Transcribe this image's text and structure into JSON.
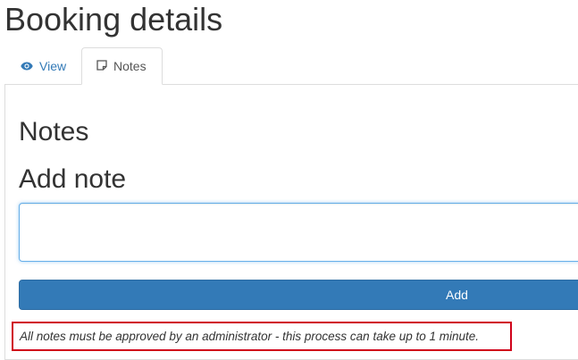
{
  "page": {
    "title": "Booking details"
  },
  "tabs": [
    {
      "label": "View",
      "icon": "eye-icon",
      "active": false
    },
    {
      "label": "Notes",
      "icon": "note-icon",
      "active": true
    }
  ],
  "notes_panel": {
    "heading": "Notes",
    "add_note_heading": "Add note",
    "note_input_value": "",
    "add_button_label": "Add",
    "approval_message": "All notes must be approved by an administrator - this process can take up to 1 minute."
  },
  "colors": {
    "link": "#337ab7",
    "primary_button": "#337ab7",
    "input_focus_border": "#66afe9",
    "highlight_border": "#d0021b"
  }
}
